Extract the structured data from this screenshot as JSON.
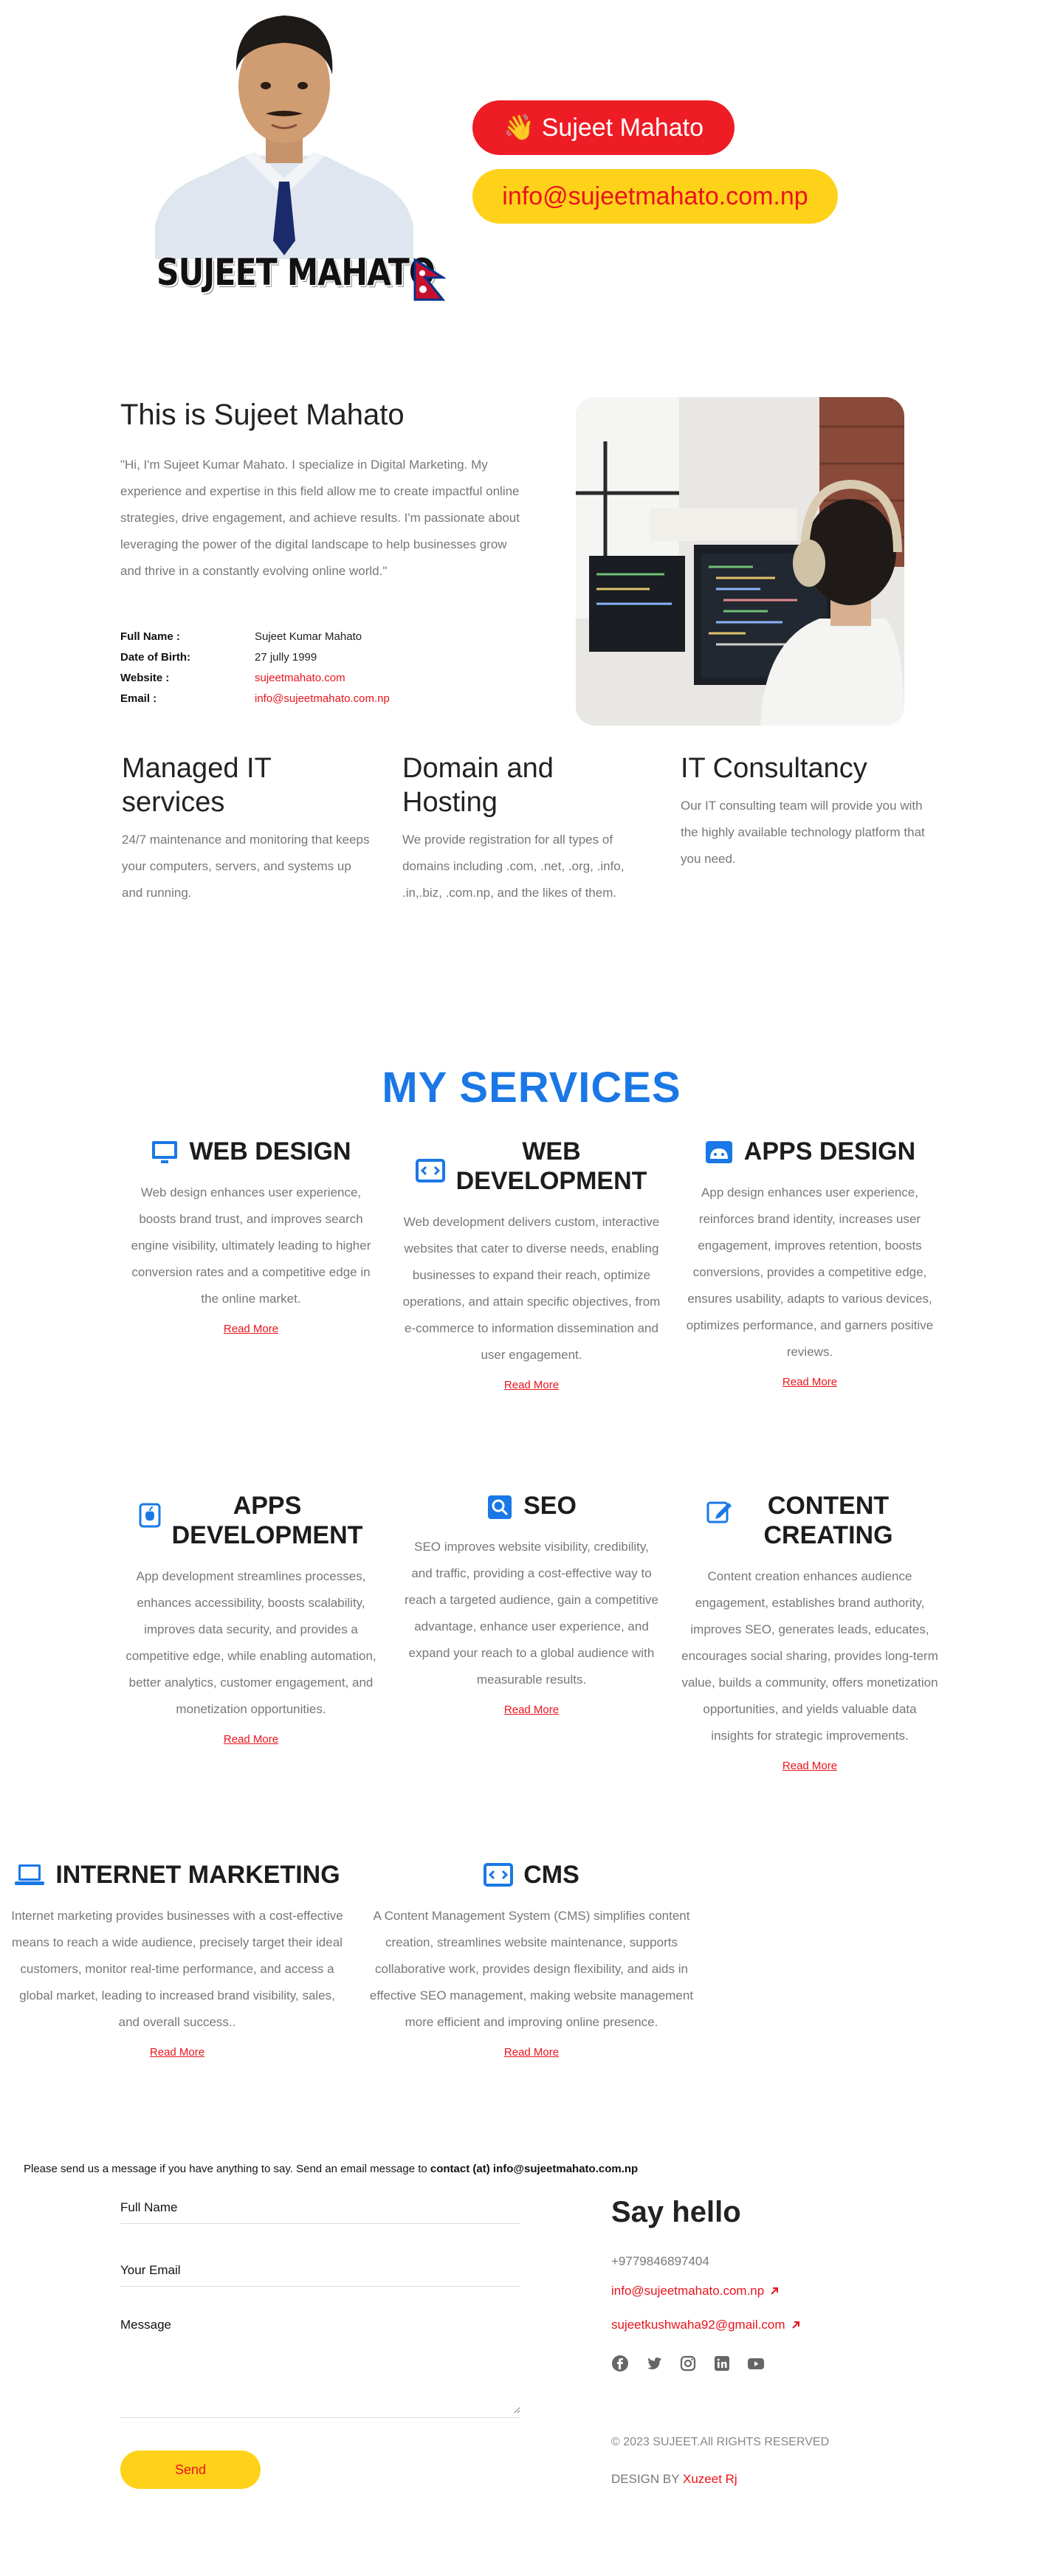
{
  "hero": {
    "logo_text": "SUJEET MAHATO",
    "name_pill": "👋 Sujeet Mahato",
    "email_pill": "info@sujeetmahato.com.np",
    "colors": {
      "red": "#ee1c25",
      "yellow": "#ffd21a"
    }
  },
  "about": {
    "title": "This is Sujeet Mahato",
    "text": "\"Hi, I'm Sujeet Kumar Mahato. I specialize in Digital Marketing. My experience and expertise in this field allow me to create impactful online strategies, drive engagement, and achieve results. I'm passionate about leveraging the power of the digital landscape to help businesses grow and thrive in a constantly evolving online world.\"",
    "info": [
      {
        "key": "Full Name :",
        "value": "Sujeet Kumar Mahato"
      },
      {
        "key": "Date of Birth:",
        "value": "27 jully 1999"
      },
      {
        "key": "Website :",
        "value": "sujeetmahato.com"
      },
      {
        "key": "Email :",
        "value": "info@sujeetmahato.com.np"
      }
    ]
  },
  "features": [
    {
      "title": "Managed IT services",
      "text": "24/7 maintenance and monitoring that keeps your computers, servers, and systems up and running."
    },
    {
      "title": "Domain and Hosting",
      "text": "We provide registration for all types of domains including .com, .net, .org, .info, .in,.biz, .com.np, and the likes of them."
    },
    {
      "title": "IT Consultancy",
      "text": "Our IT consulting team will provide you with the highly available technology platform that you need."
    }
  ],
  "services": {
    "heading": "MY SERVICES",
    "read_more": "Read More",
    "items": [
      {
        "title": "WEB DESIGN",
        "icon": "monitor-icon",
        "text": "Web design enhances user experience, boosts brand trust, and improves search engine visibility, ultimately leading to higher conversion rates and a competitive edge in the online market."
      },
      {
        "title": "WEB DEVELOPMENT",
        "icon": "code-icon",
        "text": "Web development delivers custom, interactive websites that cater to diverse needs, enabling businesses to expand their reach, optimize operations, and attain specific objectives, from e-commerce to information dissemination and user engagement."
      },
      {
        "title": "APPS DESIGN",
        "icon": "android-icon",
        "text": "App design enhances user experience, reinforces brand identity, increases user engagement, improves retention, boosts conversions, provides a competitive edge, ensures usability, adapts to various devices, optimizes performance, and garners positive reviews."
      },
      {
        "title": "APPS DEVELOPMENT",
        "icon": "apple-icon",
        "text": "App development streamlines processes, enhances accessibility, boosts scalability, improves data security, and provides a competitive edge, while enabling automation, better analytics, customer engagement, and monetization opportunities."
      },
      {
        "title": "SEO",
        "icon": "search-icon",
        "text": "SEO improves website visibility, credibility, and traffic, providing a cost-effective way to reach a targeted audience, gain a competitive advantage, enhance user experience, and expand your reach to a global audience with measurable results."
      },
      {
        "title": "CONTENT CREATING",
        "icon": "edit-icon",
        "text": "Content creation enhances audience engagement, establishes brand authority, improves SEO, generates leads, educates, encourages social sharing, provides long-term value, builds a community, offers monetization opportunities, and yields valuable data insights for strategic improvements."
      },
      {
        "title": "INTERNET MARKETING",
        "icon": "laptop-icon",
        "text": "Internet marketing provides businesses with a cost-effective means to reach a wide audience, precisely target their ideal customers, monitor real-time performance, and access a global market, leading to increased brand visibility, sales, and overall success.."
      },
      {
        "title": "CMS",
        "icon": "code-icon",
        "text": "A Content Management System (CMS) simplifies content creation, streamlines website maintenance, supports collaborative work, provides design flexibility, and aids in effective SEO management, making website management more efficient and improving online presence."
      }
    ]
  },
  "contact": {
    "note_prefix": "Please send us a message if you have anything to say. Send an email message to ",
    "note_bold": "contact (at) info@sujeetmahato.com.np",
    "full_name_placeholder": "Full Name",
    "email_placeholder": "Your Email",
    "message_placeholder": "Message",
    "send_label": "Send"
  },
  "hello": {
    "title": "Say hello",
    "phone": "+9779846897404",
    "email1": "info@sujeetmahato.com.np",
    "email2": "sujeetkushwaha92@gmail.com",
    "socials": [
      "facebook-icon",
      "twitter-icon",
      "instagram-icon",
      "linkedin-icon",
      "youtube-icon"
    ]
  },
  "footer": {
    "copyright": "© 2023 SUJEET.All RIGHTS RESERVED",
    "design_by_prefix": "DESIGN BY ",
    "designer": "Xuzeet Rj"
  }
}
